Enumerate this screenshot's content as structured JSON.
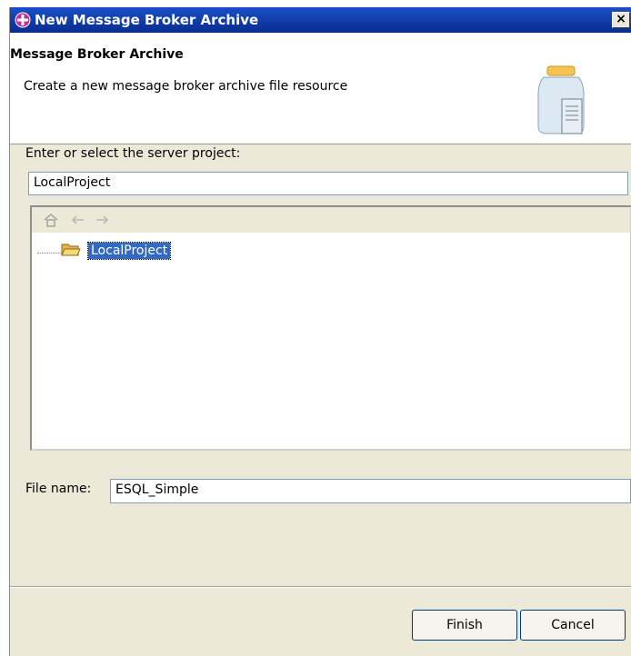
{
  "window": {
    "title": "New Message Broker Archive",
    "close_label": "×"
  },
  "banner": {
    "heading": "Message Broker Archive",
    "description": "Create a new message broker archive file resource"
  },
  "project": {
    "label": "Enter or select the server project:",
    "value": "LocalProject"
  },
  "tree": {
    "items": [
      {
        "label": "LocalProject",
        "selected": true
      }
    ]
  },
  "file": {
    "label": "File name:",
    "value": "ESQL_Simple"
  },
  "buttons": {
    "finish": "Finish",
    "cancel": "Cancel"
  },
  "colors": {
    "titlebar": "#0a2b8e",
    "selection": "#316ac5",
    "dialog_bg": "#ece9d8"
  }
}
